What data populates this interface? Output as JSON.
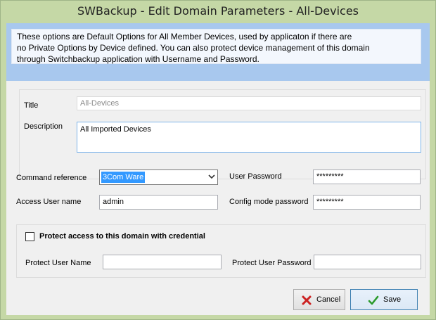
{
  "window": {
    "title": "SWBackup - Edit Domain Parameters - All-Devices"
  },
  "info": {
    "line1": "These options are Default Options for All Member Devices, used by applicaton if there are",
    "line2": "no Private Options by Device defined. You can also protect device management of this domain",
    "line3": "through Switchbackup application with Username and Password."
  },
  "general": {
    "title_label": "Title",
    "title_value": "All-Devices",
    "description_label": "Description",
    "description_value": "All Imported Devices"
  },
  "options": {
    "command_reference_label": "Command reference",
    "command_reference_value": "3Com Ware",
    "access_user_label": "Access User name",
    "access_user_value": "admin",
    "user_password_label": "User Password",
    "user_password_value": "*********",
    "config_password_label": "Config mode password",
    "config_password_value": "*********"
  },
  "protect": {
    "checkbox_label": "Protect access to this domain with credential",
    "checked": false,
    "user_label": "Protect User Name",
    "user_value": "",
    "password_label": "Protect User Password",
    "password_value": ""
  },
  "buttons": {
    "cancel": "Cancel",
    "save": "Save"
  },
  "colors": {
    "title_bar": "#c5d8a6",
    "info_band": "#a8c8ee",
    "selection": "#3399ff",
    "cancel_icon": "#cc2222",
    "save_icon": "#2a9a2a"
  },
  "icons": {
    "cancel": "red-x-icon",
    "save": "green-checkmark-icon",
    "dropdown": "chevron-down-icon"
  }
}
